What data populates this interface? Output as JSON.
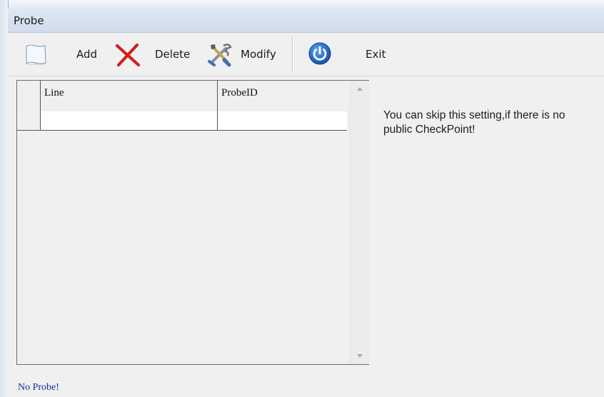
{
  "window": {
    "title": "Probe"
  },
  "toolbar": {
    "add_label": "Add",
    "delete_label": "Delete",
    "modify_label": "Modify",
    "exit_label": "Exit",
    "icons": [
      "new-document-icon",
      "delete-x-icon",
      "tools-icon",
      "power-icon"
    ],
    "colors": {
      "delete": "#d11f1f",
      "power": "#1f6fd0"
    }
  },
  "grid": {
    "columns": [
      "Line",
      "ProbeID"
    ],
    "rows": [
      [
        "",
        ""
      ]
    ]
  },
  "info": {
    "message": "You can skip this setting,if there is no public CheckPoint!"
  },
  "status": {
    "text": "No Probe!"
  }
}
